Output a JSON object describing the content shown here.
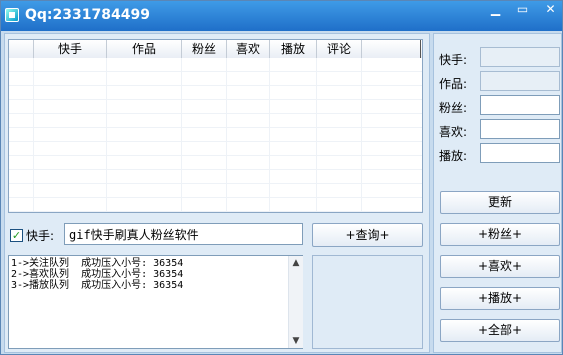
{
  "window": {
    "title": "Qq:2331784499"
  },
  "titlebar": {
    "min": "▁",
    "max": "▭",
    "close": "✕"
  },
  "listview": {
    "columns": [
      "快手",
      "作品",
      "粉丝",
      "喜欢",
      "播放",
      "评论"
    ]
  },
  "search": {
    "checkbox_label": "快手:",
    "checked": true,
    "checkmark": "✓",
    "value": "gif快手刷真人粉丝软件",
    "query_button": "+查询+"
  },
  "log": {
    "lines": [
      "1->关注队列  成功压入小号: 36354",
      "2->喜欢队列  成功压入小号: 36354",
      "3->播放队列  成功压入小号: 36354"
    ]
  },
  "side_fields": [
    {
      "label": "快手:"
    },
    {
      "label": "作品:"
    },
    {
      "label": "粉丝:"
    },
    {
      "label": "喜欢:"
    },
    {
      "label": "播放:"
    }
  ],
  "buttons": {
    "update": "更新",
    "fans": "+粉丝+",
    "like": "+喜欢+",
    "play": "+播放+",
    "all": "+全部+"
  },
  "scroll": {
    "up": "▲",
    "down": "▼"
  }
}
